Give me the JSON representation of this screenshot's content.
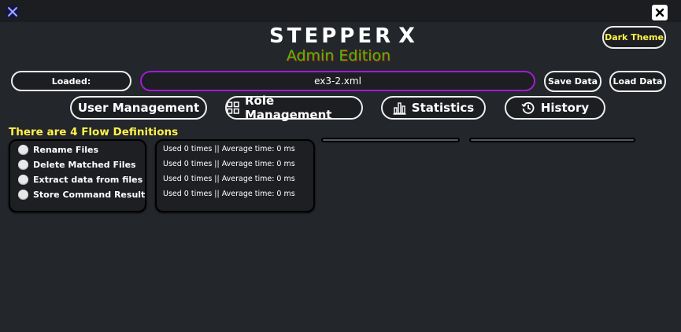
{
  "app": {
    "title": "STEPPER",
    "title_x": "X",
    "edition": "Admin Edition",
    "icons": {
      "app": "stepper-x-app-icon",
      "close": "close-icon",
      "brand": "sparkle-wand-icon"
    }
  },
  "toolbar": {
    "theme_label": "Dark Theme",
    "loaded_label": "Loaded:",
    "loaded_file": "ex3-2.xml",
    "save_label": "Save Data",
    "load_label": "Load Data"
  },
  "nav": {
    "users": {
      "label": "User Management",
      "icon": ""
    },
    "roles": {
      "label": "Role Management",
      "icon": "grid-icon"
    },
    "stats": {
      "label": "Statistics",
      "icon": "bar-chart-icon"
    },
    "history": {
      "label": "History",
      "icon": "history-icon"
    }
  },
  "flows": {
    "heading": "There are 4 Flow Definitions",
    "items": [
      {
        "name": "Rename Files",
        "stats": "Used 0 times || Average time: 0 ms"
      },
      {
        "name": "Delete Matched Files",
        "stats": "Used 0 times || Average time: 0 ms"
      },
      {
        "name": "Extract data from files",
        "stats": "Used 0 times || Average time: 0 ms"
      },
      {
        "name": "Store Command Result",
        "stats": "Used 0 times || Average time: 0 ms"
      }
    ]
  },
  "colors": {
    "background": "#23262a",
    "accent_yellow": "#fff14a",
    "edition_green": "#3ac40c",
    "file_border": "#a21bd6"
  }
}
